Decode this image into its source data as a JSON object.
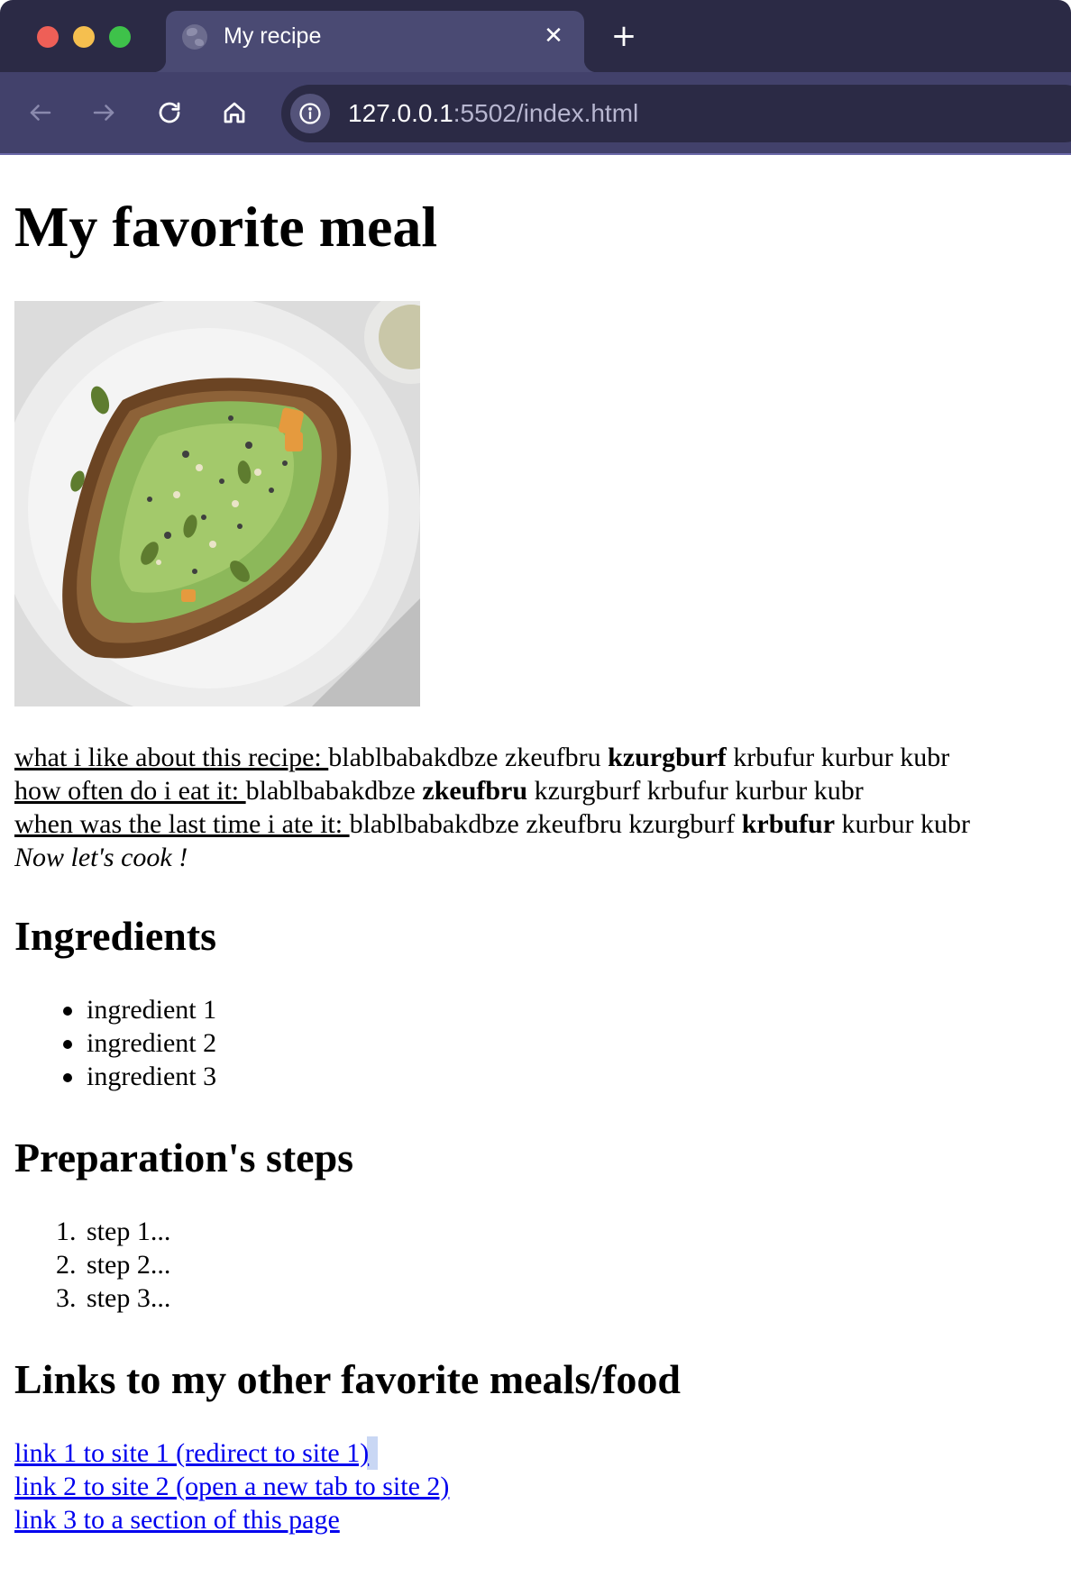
{
  "browser": {
    "tab_title": "My recipe",
    "url_host": "127.0.0.1",
    "url_path": ":5502/index.html",
    "icons": {
      "tab_favicon": "globe-icon",
      "tab_close": "close-icon",
      "new_tab": "plus-icon",
      "back": "arrow-left-icon",
      "forward": "arrow-right-icon",
      "reload": "reload-icon",
      "home": "home-icon",
      "site_info": "info-icon"
    },
    "colors": {
      "titlebar": "#2b2a45",
      "active_tab": "#4a4a73",
      "toolbar": "#42416b",
      "urlbar": "#2b2a45"
    }
  },
  "page": {
    "title": "My favorite meal",
    "image_description_icon": "avocado-toast-photo",
    "paragraph": {
      "line1_label": "what i like about this recipe: ",
      "line1_a": "blablbabakdbze zkeufbru ",
      "line1_bold": "kzurgburf",
      "line1_b": " krbufur kurbur kubr",
      "line2_label": "how often do i eat it: ",
      "line2_a": "blablbabakdbze ",
      "line2_bold": "zkeufbru",
      "line2_b": " kzurgburf krbufur kurbur kubr",
      "line3_label": "when was the last time i ate it: ",
      "line3_a": "blablbabakdbze zkeufbru kzurgburf ",
      "line3_bold": "krbufur",
      "line3_b": " kurbur kubr",
      "italic": "Now let's cook !"
    },
    "ingredients": {
      "heading": "Ingredients",
      "items": [
        "ingredient 1",
        "ingredient 2",
        "ingredient 3"
      ]
    },
    "steps": {
      "heading": "Preparation's steps",
      "items": [
        {
          "num": "1.",
          "text": "step 1..."
        },
        {
          "num": "2.",
          "text": "step 2..."
        },
        {
          "num": "3.",
          "text": "step 3..."
        }
      ]
    },
    "links": {
      "heading": "Links to my other favorite meals/food",
      "items": [
        "link 1 to site 1 (redirect to site 1)",
        "link 2 to site 2 (open a new tab to site 2)",
        "link 3 to a section of this page"
      ],
      "link_color": "#0000ee"
    }
  }
}
